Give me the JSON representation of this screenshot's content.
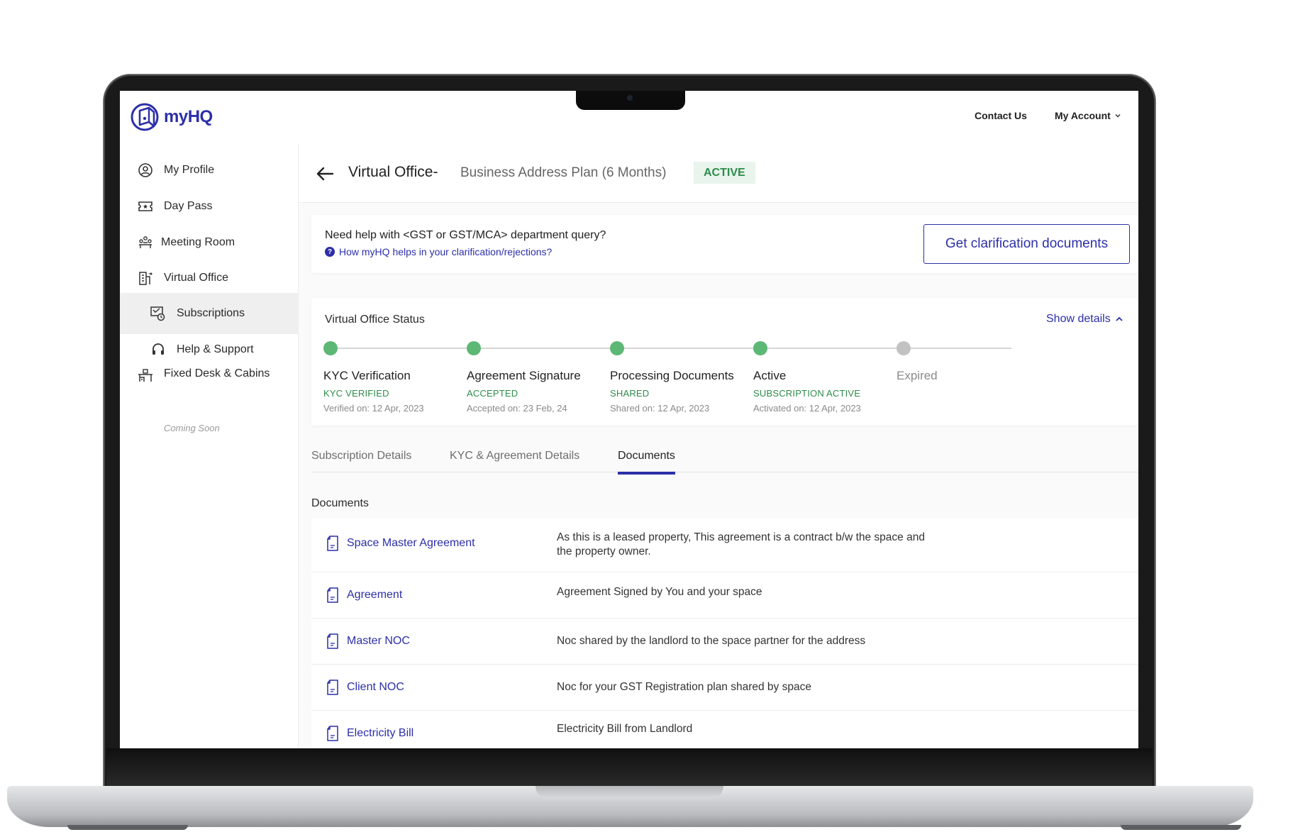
{
  "brand": {
    "name": "myHQ",
    "color": "#2c2fa8"
  },
  "topnav": {
    "contact": "Contact Us",
    "account": "My Account"
  },
  "sidebar": {
    "items": [
      {
        "label": "My Profile",
        "icon": "user-circle-icon"
      },
      {
        "label": "Day Pass",
        "icon": "ticket-icon"
      },
      {
        "label": "Meeting Room",
        "icon": "meeting-icon"
      },
      {
        "label": "Virtual Office",
        "icon": "building-icon"
      },
      {
        "label": "Subscriptions",
        "icon": "subscription-icon",
        "active": true
      },
      {
        "label": "Help & Support",
        "icon": "headset-icon"
      },
      {
        "label": "Fixed Desk & Cabins",
        "icon": "desk-icon",
        "note": "Coming Soon"
      }
    ]
  },
  "header": {
    "title": "Virtual Office-",
    "subtitle": "Business Address Plan (6 Months)",
    "badge": "ACTIVE"
  },
  "help": {
    "question": "Need help with <GST or GST/MCA> department query?",
    "link": "How myHQ helps in your clarification/rejections?",
    "button": "Get clarification documents"
  },
  "status": {
    "title": "Virtual Office Status",
    "toggle": "Show details",
    "steps": [
      {
        "name": "KYC Verification",
        "state": "KYC VERIFIED",
        "date": "Verified on: 12 Apr, 2023",
        "done": true
      },
      {
        "name": "Agreement Signature",
        "state": "ACCEPTED",
        "date": "Accepted on: 23 Feb, 24",
        "done": true
      },
      {
        "name": "Processing Documents",
        "state": "SHARED",
        "date": "Shared on: 12 Apr, 2023",
        "done": true
      },
      {
        "name": "Active",
        "state": "SUBSCRIPTION ACTIVE",
        "date": "Activated on: 12 Apr, 2023",
        "done": true
      },
      {
        "name": "Expired",
        "state": "",
        "date": "",
        "done": false
      }
    ]
  },
  "tabs": [
    {
      "label": "Subscription Details"
    },
    {
      "label": "KYC & Agreement Details"
    },
    {
      "label": "Documents",
      "active": true
    }
  ],
  "documents": {
    "heading": "Documents",
    "rows": [
      {
        "name": "Space Master Agreement",
        "desc": "As this is a leased property, This agreement is a contract b/w the space and the property owner."
      },
      {
        "name": "Agreement",
        "desc": "Agreement Signed by You and your space"
      },
      {
        "name": "Master NOC",
        "desc": "Noc shared by the landlord to the space partner for the address"
      },
      {
        "name": "Client NOC",
        "desc": "Noc for your GST Registration plan shared by space"
      },
      {
        "name": "Electricity Bill",
        "desc": "Electricity Bill from Landlord"
      }
    ]
  }
}
